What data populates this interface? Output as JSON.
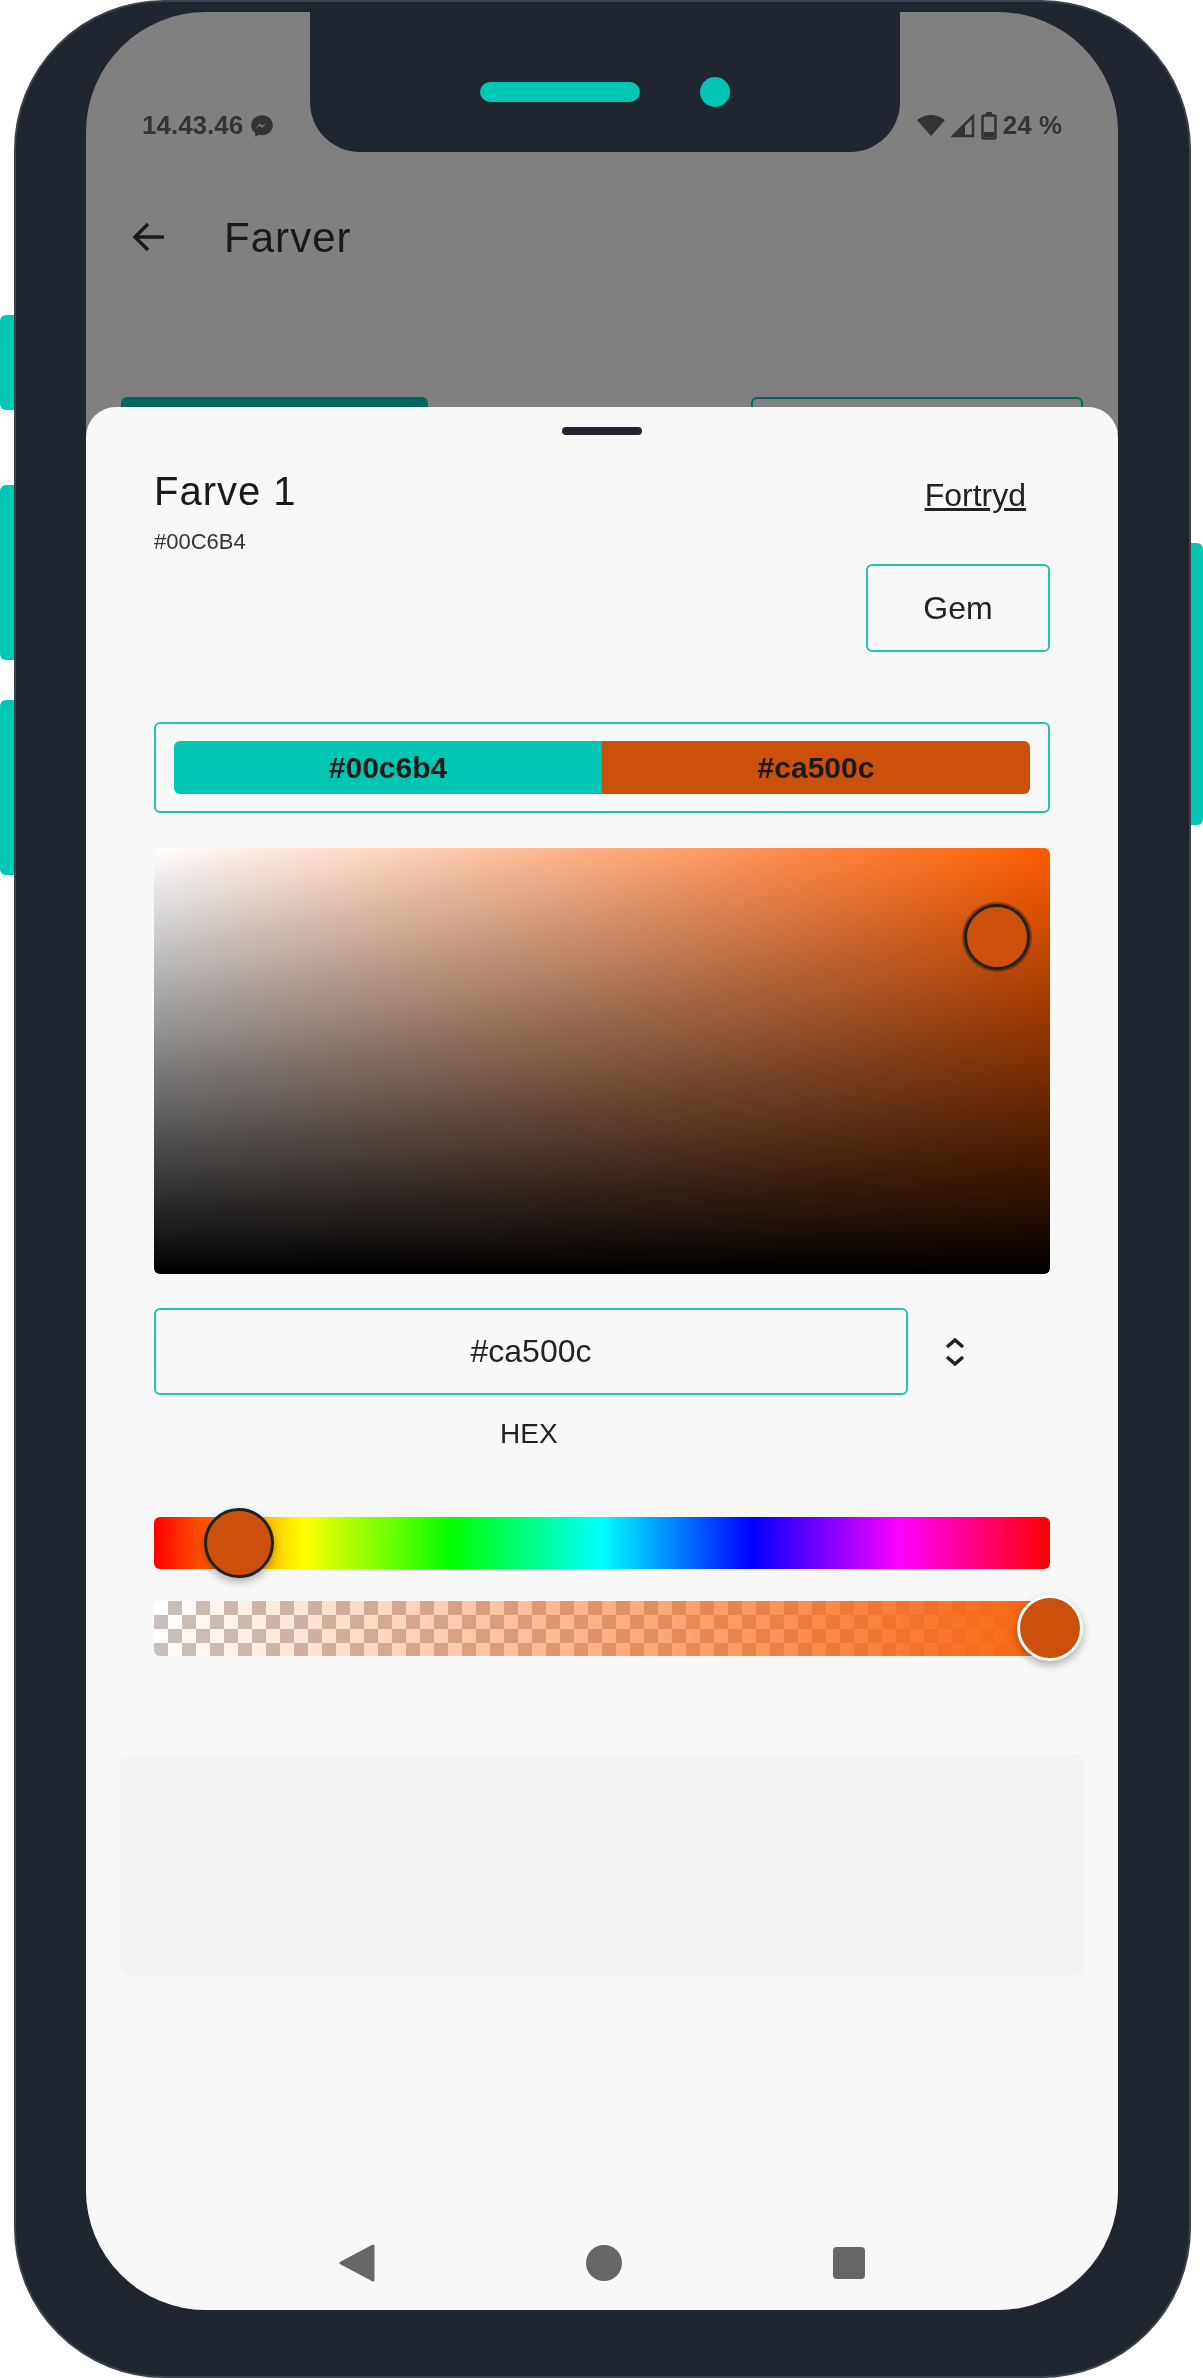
{
  "status_bar": {
    "time": "14.43.46",
    "battery": "24 %"
  },
  "app_bar": {
    "title": "Farver"
  },
  "sheet": {
    "title": "Farve 1",
    "subtitle": "#00C6B4",
    "cancel": "Fortryd",
    "save": "Gem",
    "swatches": [
      {
        "label": "#00c6b4",
        "color": "#00c6b4"
      },
      {
        "label": "#ca500c",
        "color": "#ca500c"
      }
    ],
    "hex_field": {
      "value": "#ca500c"
    },
    "format_label": "HEX",
    "hue_slider": {
      "level": 0.06
    },
    "alpha_slider": {
      "level": 1
    }
  }
}
